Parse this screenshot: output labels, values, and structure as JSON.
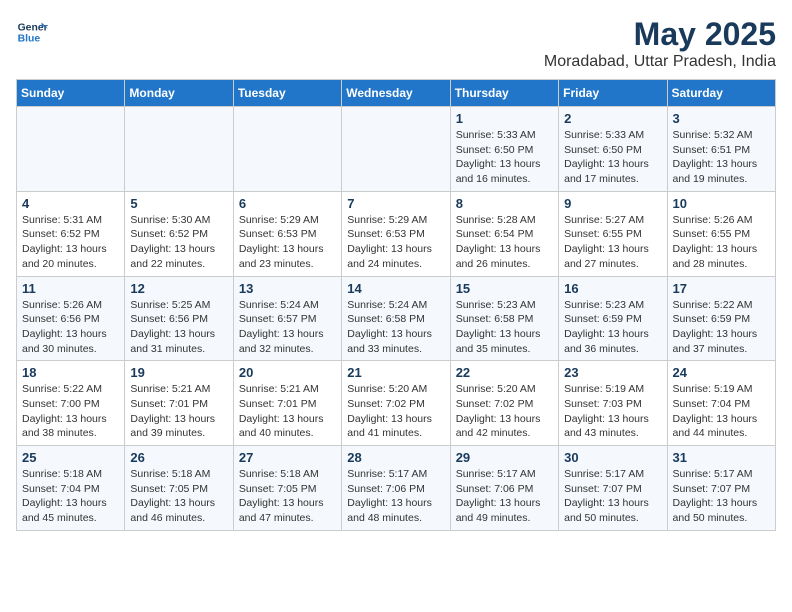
{
  "header": {
    "logo_line1": "General",
    "logo_line2": "Blue",
    "month": "May 2025",
    "location": "Moradabad, Uttar Pradesh, India"
  },
  "days_of_week": [
    "Sunday",
    "Monday",
    "Tuesday",
    "Wednesday",
    "Thursday",
    "Friday",
    "Saturday"
  ],
  "weeks": [
    [
      {
        "day": "",
        "info": ""
      },
      {
        "day": "",
        "info": ""
      },
      {
        "day": "",
        "info": ""
      },
      {
        "day": "",
        "info": ""
      },
      {
        "day": "1",
        "info": "Sunrise: 5:33 AM\nSunset: 6:50 PM\nDaylight: 13 hours\nand 16 minutes."
      },
      {
        "day": "2",
        "info": "Sunrise: 5:33 AM\nSunset: 6:50 PM\nDaylight: 13 hours\nand 17 minutes."
      },
      {
        "day": "3",
        "info": "Sunrise: 5:32 AM\nSunset: 6:51 PM\nDaylight: 13 hours\nand 19 minutes."
      }
    ],
    [
      {
        "day": "4",
        "info": "Sunrise: 5:31 AM\nSunset: 6:52 PM\nDaylight: 13 hours\nand 20 minutes."
      },
      {
        "day": "5",
        "info": "Sunrise: 5:30 AM\nSunset: 6:52 PM\nDaylight: 13 hours\nand 22 minutes."
      },
      {
        "day": "6",
        "info": "Sunrise: 5:29 AM\nSunset: 6:53 PM\nDaylight: 13 hours\nand 23 minutes."
      },
      {
        "day": "7",
        "info": "Sunrise: 5:29 AM\nSunset: 6:53 PM\nDaylight: 13 hours\nand 24 minutes."
      },
      {
        "day": "8",
        "info": "Sunrise: 5:28 AM\nSunset: 6:54 PM\nDaylight: 13 hours\nand 26 minutes."
      },
      {
        "day": "9",
        "info": "Sunrise: 5:27 AM\nSunset: 6:55 PM\nDaylight: 13 hours\nand 27 minutes."
      },
      {
        "day": "10",
        "info": "Sunrise: 5:26 AM\nSunset: 6:55 PM\nDaylight: 13 hours\nand 28 minutes."
      }
    ],
    [
      {
        "day": "11",
        "info": "Sunrise: 5:26 AM\nSunset: 6:56 PM\nDaylight: 13 hours\nand 30 minutes."
      },
      {
        "day": "12",
        "info": "Sunrise: 5:25 AM\nSunset: 6:56 PM\nDaylight: 13 hours\nand 31 minutes."
      },
      {
        "day": "13",
        "info": "Sunrise: 5:24 AM\nSunset: 6:57 PM\nDaylight: 13 hours\nand 32 minutes."
      },
      {
        "day": "14",
        "info": "Sunrise: 5:24 AM\nSunset: 6:58 PM\nDaylight: 13 hours\nand 33 minutes."
      },
      {
        "day": "15",
        "info": "Sunrise: 5:23 AM\nSunset: 6:58 PM\nDaylight: 13 hours\nand 35 minutes."
      },
      {
        "day": "16",
        "info": "Sunrise: 5:23 AM\nSunset: 6:59 PM\nDaylight: 13 hours\nand 36 minutes."
      },
      {
        "day": "17",
        "info": "Sunrise: 5:22 AM\nSunset: 6:59 PM\nDaylight: 13 hours\nand 37 minutes."
      }
    ],
    [
      {
        "day": "18",
        "info": "Sunrise: 5:22 AM\nSunset: 7:00 PM\nDaylight: 13 hours\nand 38 minutes."
      },
      {
        "day": "19",
        "info": "Sunrise: 5:21 AM\nSunset: 7:01 PM\nDaylight: 13 hours\nand 39 minutes."
      },
      {
        "day": "20",
        "info": "Sunrise: 5:21 AM\nSunset: 7:01 PM\nDaylight: 13 hours\nand 40 minutes."
      },
      {
        "day": "21",
        "info": "Sunrise: 5:20 AM\nSunset: 7:02 PM\nDaylight: 13 hours\nand 41 minutes."
      },
      {
        "day": "22",
        "info": "Sunrise: 5:20 AM\nSunset: 7:02 PM\nDaylight: 13 hours\nand 42 minutes."
      },
      {
        "day": "23",
        "info": "Sunrise: 5:19 AM\nSunset: 7:03 PM\nDaylight: 13 hours\nand 43 minutes."
      },
      {
        "day": "24",
        "info": "Sunrise: 5:19 AM\nSunset: 7:04 PM\nDaylight: 13 hours\nand 44 minutes."
      }
    ],
    [
      {
        "day": "25",
        "info": "Sunrise: 5:18 AM\nSunset: 7:04 PM\nDaylight: 13 hours\nand 45 minutes."
      },
      {
        "day": "26",
        "info": "Sunrise: 5:18 AM\nSunset: 7:05 PM\nDaylight: 13 hours\nand 46 minutes."
      },
      {
        "day": "27",
        "info": "Sunrise: 5:18 AM\nSunset: 7:05 PM\nDaylight: 13 hours\nand 47 minutes."
      },
      {
        "day": "28",
        "info": "Sunrise: 5:17 AM\nSunset: 7:06 PM\nDaylight: 13 hours\nand 48 minutes."
      },
      {
        "day": "29",
        "info": "Sunrise: 5:17 AM\nSunset: 7:06 PM\nDaylight: 13 hours\nand 49 minutes."
      },
      {
        "day": "30",
        "info": "Sunrise: 5:17 AM\nSunset: 7:07 PM\nDaylight: 13 hours\nand 50 minutes."
      },
      {
        "day": "31",
        "info": "Sunrise: 5:17 AM\nSunset: 7:07 PM\nDaylight: 13 hours\nand 50 minutes."
      }
    ]
  ]
}
